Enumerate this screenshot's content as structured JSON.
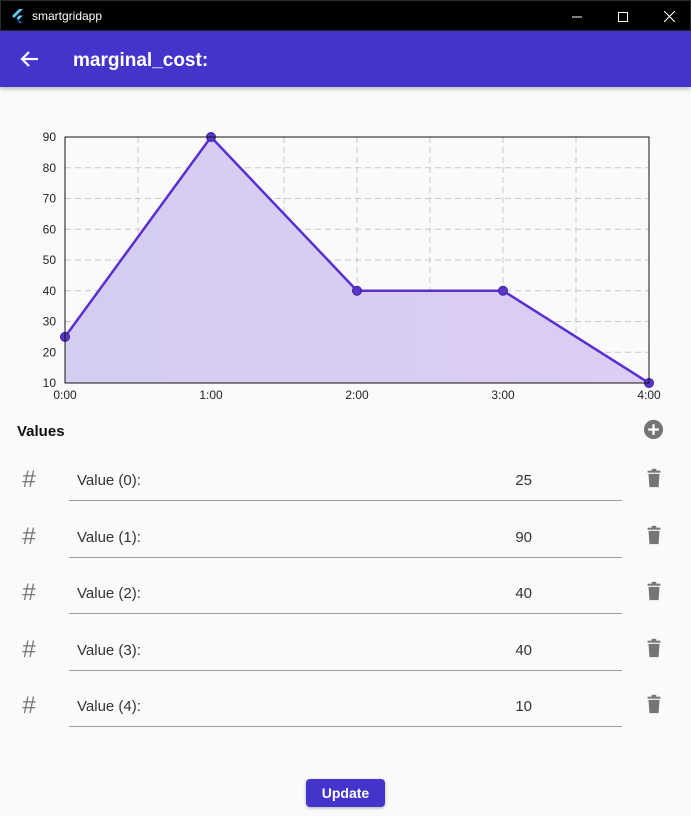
{
  "window": {
    "title": "smartgridapp",
    "icon": "flutter-logo-icon"
  },
  "appbar": {
    "title": "marginal_cost:",
    "back_icon": "arrow-back-icon"
  },
  "colors": {
    "primary": "#4335cc",
    "line": "#5a2fcf",
    "fill": "#d9cff0"
  },
  "chart_data": {
    "type": "area",
    "x": [
      "0:00",
      "1:00",
      "2:00",
      "3:00",
      "4:00"
    ],
    "series": [
      {
        "values": [
          25,
          90,
          40,
          40,
          10
        ]
      }
    ],
    "ylim": [
      10,
      90
    ],
    "yticks": [
      "10",
      "20",
      "30",
      "40",
      "50",
      "60",
      "70",
      "80",
      "90"
    ],
    "grid": true,
    "title": "",
    "xlabel": "",
    "ylabel": ""
  },
  "values_section": {
    "header": "Values",
    "add_icon": "add-circle-icon",
    "row_icon": "hash-icon",
    "delete_icon": "trash-icon",
    "items": [
      {
        "label": "Value (0):",
        "value": "25"
      },
      {
        "label": "Value (1):",
        "value": "90"
      },
      {
        "label": "Value (2):",
        "value": "40"
      },
      {
        "label": "Value (3):",
        "value": "40"
      },
      {
        "label": "Value (4):",
        "value": "10"
      }
    ]
  },
  "update_button": {
    "label": "Update"
  }
}
